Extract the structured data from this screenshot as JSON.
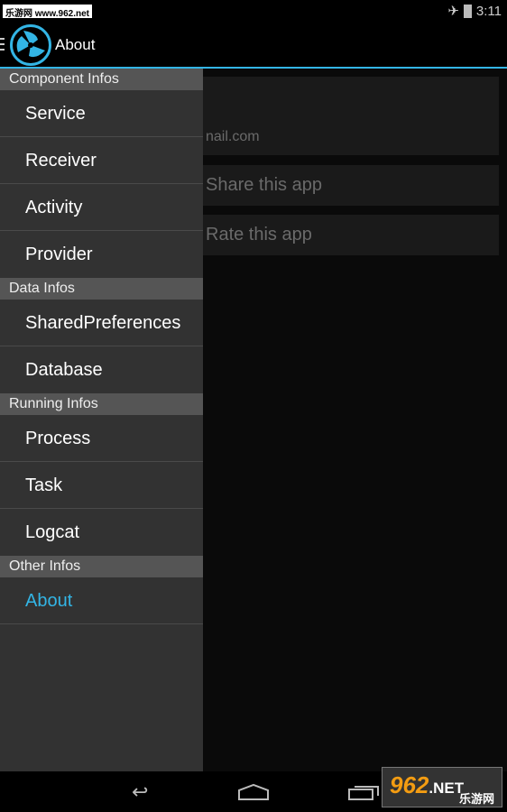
{
  "status_bar": {
    "watermark": "乐游网 www.962.net",
    "time": "3:11",
    "icons": [
      "airplane-icon",
      "battery-charging-icon"
    ]
  },
  "action_bar": {
    "title": "About",
    "icons": [
      "menu-icon",
      "app-logo-icon"
    ]
  },
  "content": {
    "email_partial": "nail.com",
    "share": "Share this app",
    "rate": "Rate this app"
  },
  "drawer": {
    "sections": [
      {
        "header": "Component Infos",
        "items": [
          "Service",
          "Receiver",
          "Activity",
          "Provider"
        ]
      },
      {
        "header": "Data Infos",
        "items": [
          "SharedPreferences",
          "Database"
        ]
      },
      {
        "header": "Running Infos",
        "items": [
          "Process",
          "Task",
          "Logcat"
        ]
      },
      {
        "header": "Other Infos",
        "items": [
          "About"
        ]
      }
    ],
    "active": "About"
  },
  "colors": {
    "accent": "#33b5e5"
  },
  "nav_bar": {
    "icons": [
      "back-icon",
      "home-icon",
      "recents-icon"
    ]
  },
  "corner_badge": {
    "number": "962",
    "suffix": ".NET",
    "sub": "乐游网"
  }
}
